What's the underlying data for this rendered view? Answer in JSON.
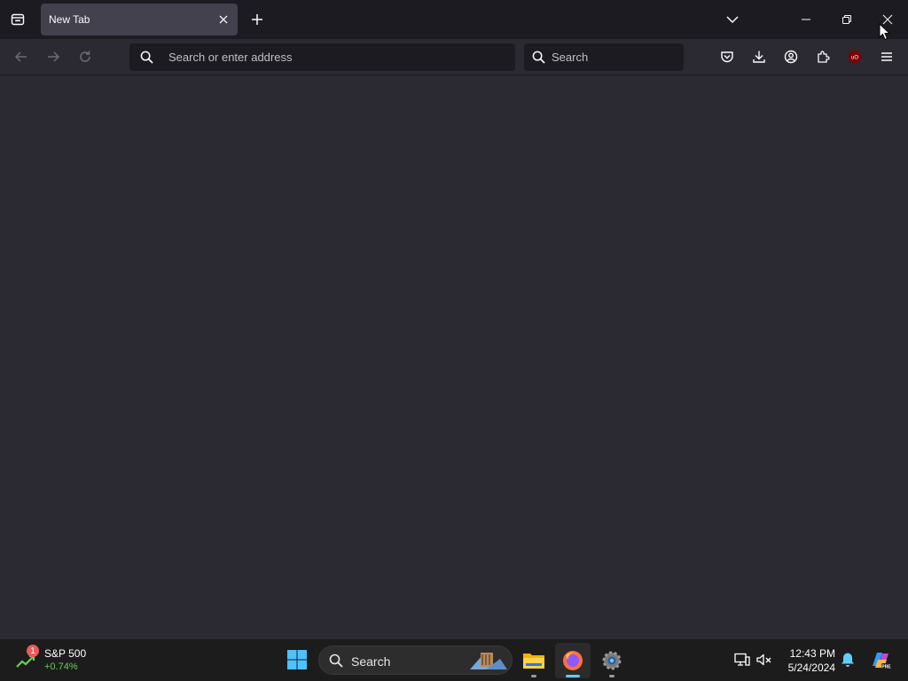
{
  "browser": {
    "tab": {
      "title": "New Tab"
    },
    "urlbar": {
      "placeholder": "Search or enter address"
    },
    "searchbar": {
      "placeholder": "Search"
    },
    "extension_badge": "uO"
  },
  "taskbar": {
    "widget": {
      "badge": "1",
      "title": "S&P 500",
      "change": "+0.74%"
    },
    "search": {
      "label": "Search"
    },
    "clock": {
      "time": "12:43 PM",
      "date": "5/24/2024"
    },
    "apps": [
      "file-explorer",
      "firefox",
      "settings"
    ]
  },
  "colors": {
    "tabbar_bg": "#1c1b22",
    "toolbar_bg": "#2b2a33",
    "content_bg": "#2b2a33",
    "active_tab": "#42414d",
    "taskbar_bg": "#1c1c1c",
    "widget_positive": "#6ccb5f",
    "firefox_active_indicator": "#60cdff"
  }
}
